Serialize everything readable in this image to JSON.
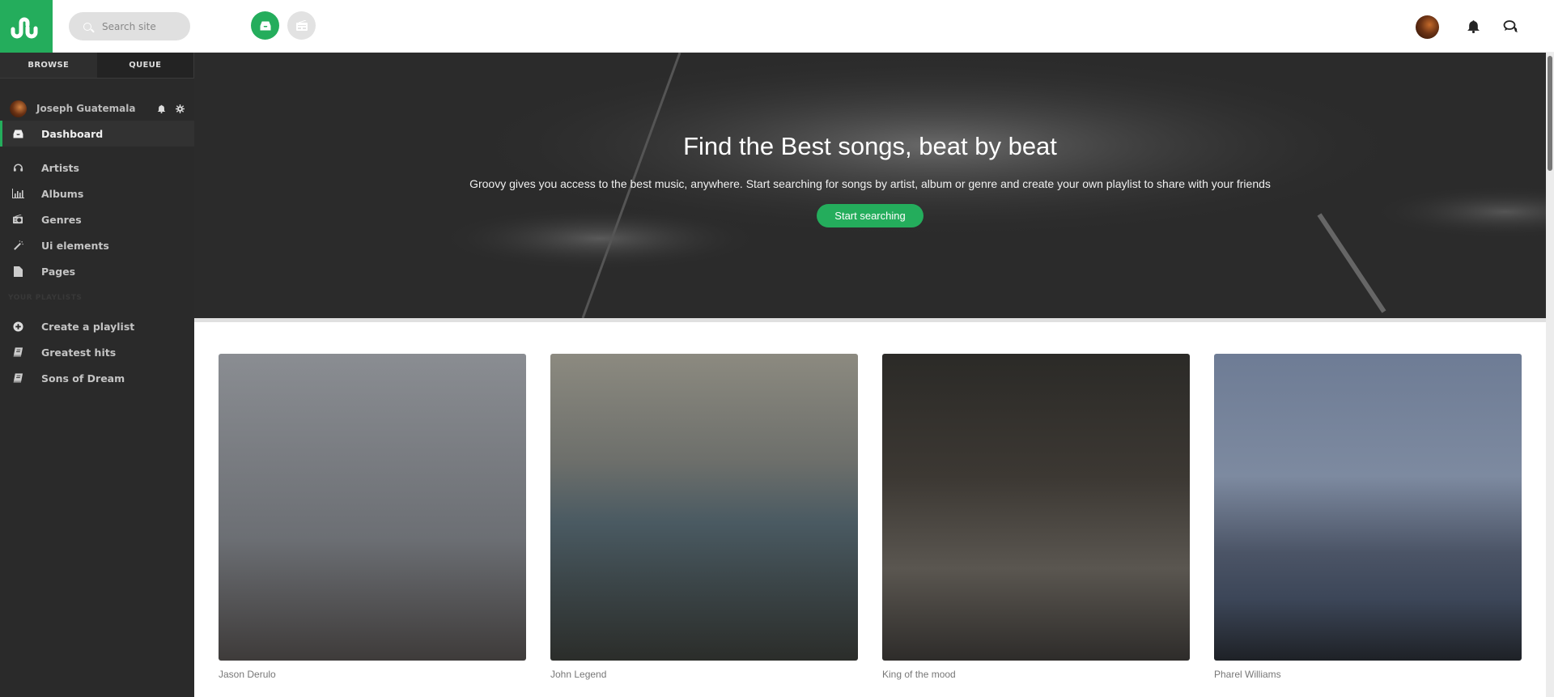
{
  "header": {
    "logo": "stumbleupon-logo",
    "search_placeholder": "Search site",
    "buttons": [
      {
        "name": "inbox",
        "active": true
      },
      {
        "name": "radio",
        "active": false
      }
    ],
    "accent_color": "#24ad5c"
  },
  "sidebar": {
    "tabs": [
      {
        "label": "BROWSE"
      },
      {
        "label": "QUEUE"
      }
    ],
    "user": {
      "name": "Joseph Guatemala"
    },
    "nav": [
      {
        "label": "Dashboard",
        "icon": "inbox-icon",
        "active": true
      },
      {
        "label": "Artists",
        "icon": "headphones-icon"
      },
      {
        "label": "Albums",
        "icon": "bar-chart-icon"
      },
      {
        "label": "Genres",
        "icon": "radio-icon"
      },
      {
        "label": "Ui elements",
        "icon": "magic-wand-icon"
      },
      {
        "label": "Pages",
        "icon": "file-icon"
      }
    ],
    "playlists_label": "YOUR PLAYLISTS",
    "playlists": [
      {
        "label": "Create a playlist",
        "icon": "plus-circle-icon"
      },
      {
        "label": "Greatest hits",
        "icon": "book-icon"
      },
      {
        "label": "Sons of Dream",
        "icon": "book-icon"
      }
    ]
  },
  "hero": {
    "title": "Find the Best songs, beat by beat",
    "description": "Groovy gives you access to the best music, anywhere. Start searching for songs by artist, album or genre and create your own playlist to share with your friends",
    "button_label": "Start searching"
  },
  "cards": [
    {
      "label": "Jason Derulo"
    },
    {
      "label": "John Legend"
    },
    {
      "label": "King of the mood"
    },
    {
      "label": "Pharel Williams"
    }
  ]
}
